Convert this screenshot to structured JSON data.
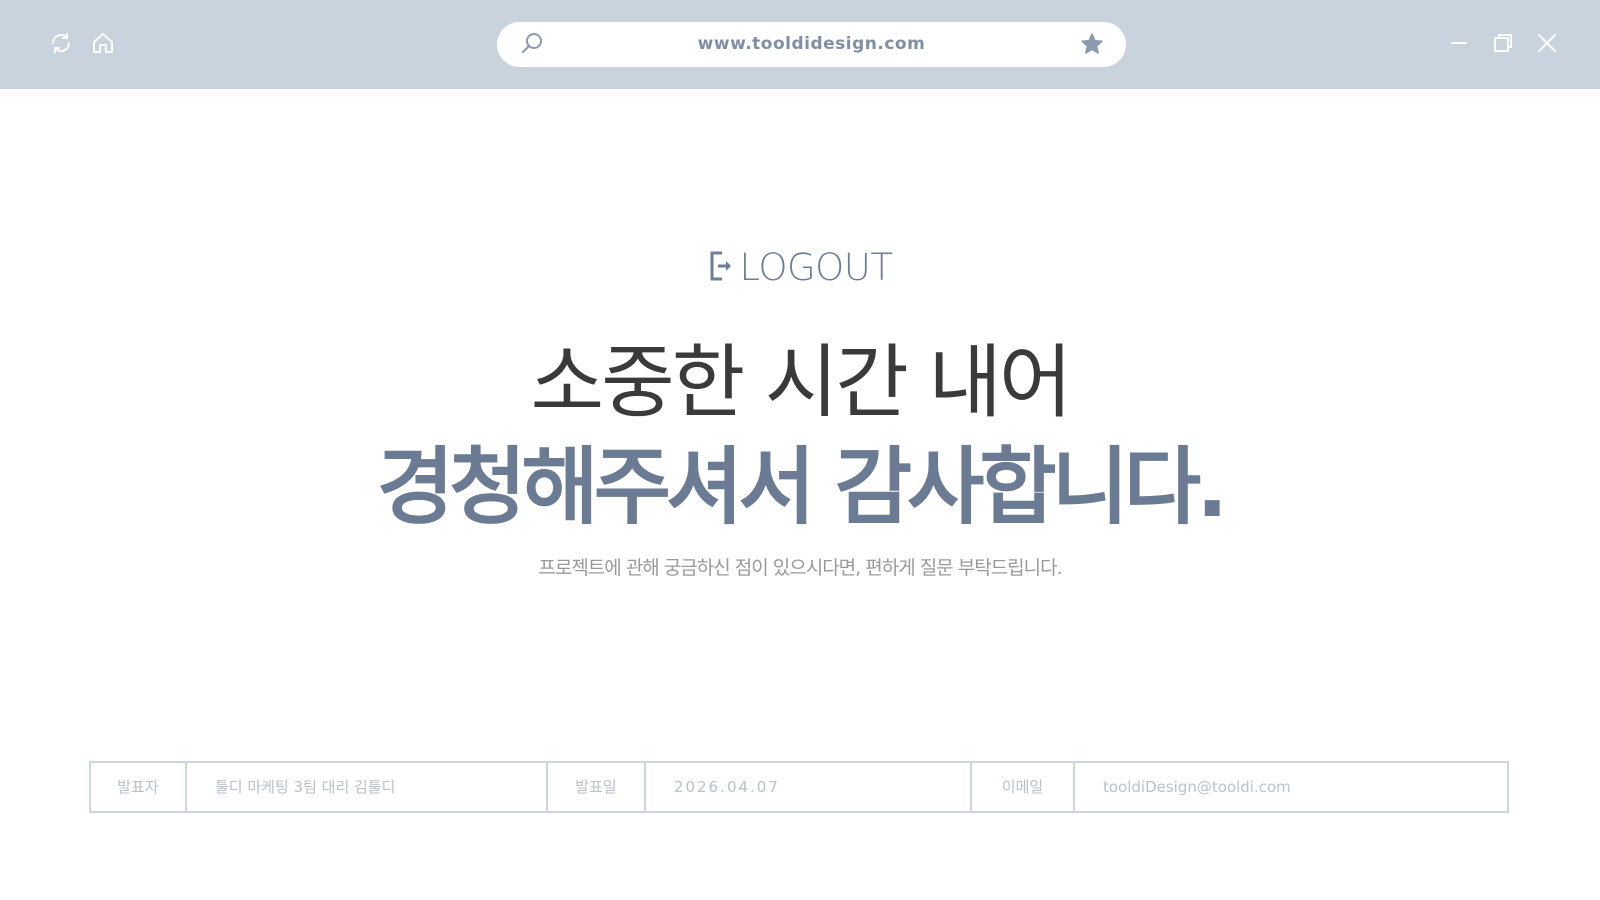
{
  "browser": {
    "url": "www.tooldidesign.com",
    "icons": {
      "refresh": "refresh-icon",
      "home": "home-icon",
      "search": "search-icon",
      "bookmark": "star-icon",
      "minimize": "minimize-icon",
      "restore": "restore-icon",
      "close": "close-icon"
    },
    "bar_color": "#c8d3de",
    "icon_color": "#8a9bb1"
  },
  "main": {
    "logout_label": "LOGOUT",
    "headline_line1": "소중한 시간 내어",
    "headline_line2": "경청해주셔서 감사합니다.",
    "subtitle": "프로젝트에 관해 궁금하신 점이 있으시다면, 편하게 질문 부탁드립니다.",
    "accent_color": "#6b7b94"
  },
  "info": {
    "presenter_label": "발표자",
    "presenter_value": "툴디 마케팅 3팀 대리 김툴디",
    "date_label": "발표일",
    "date_value": "2026.04.07",
    "email_label": "이메일",
    "email_value": "tooldiDesign@tooldi.com"
  }
}
